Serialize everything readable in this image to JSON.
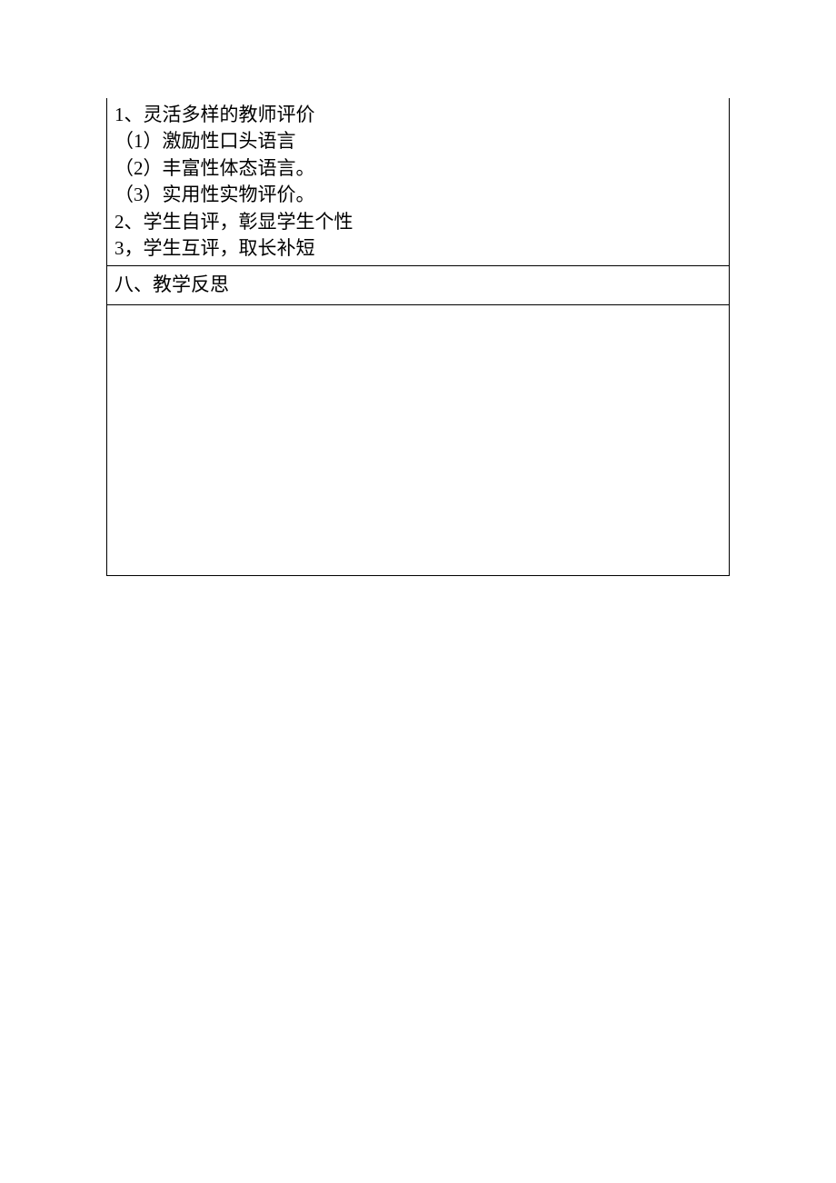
{
  "section7": {
    "lines": [
      "1、灵活多样的教师评价",
      "（1）激励性口头语言",
      "（2）丰富性体态语言。",
      "（3）实用性实物评价。",
      "2、学生自评，彰显学生个性",
      "3，学生互评，取长补短"
    ]
  },
  "section8": {
    "title": "八、教学反思"
  }
}
